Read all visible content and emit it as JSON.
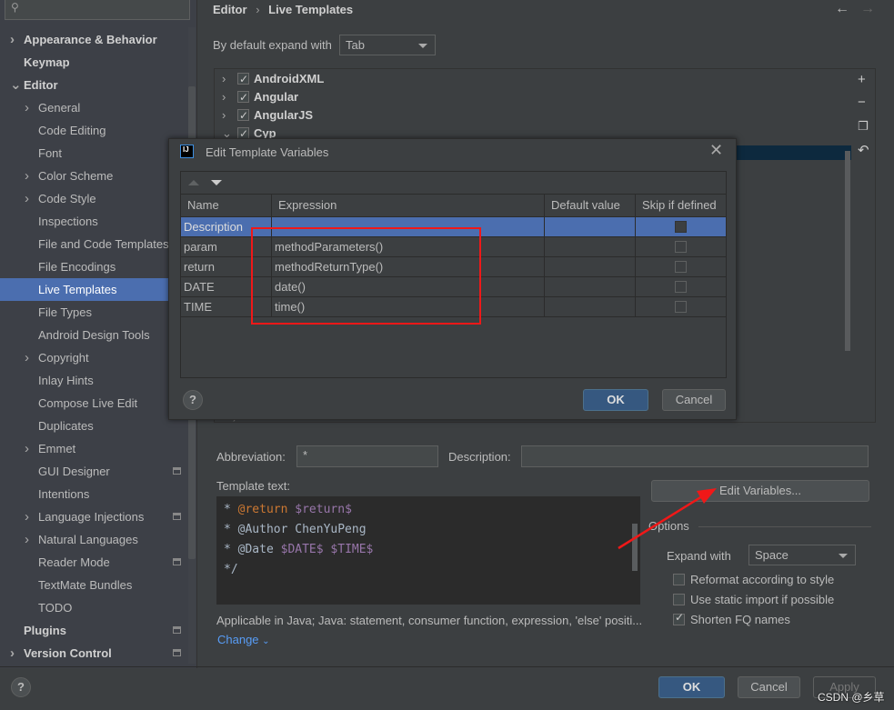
{
  "sidebar": {
    "items": [
      {
        "label": "Appearance & Behavior",
        "level": 0,
        "bold": true,
        "chevron": "right"
      },
      {
        "label": "Keymap",
        "level": 0,
        "bold": true
      },
      {
        "label": "Editor",
        "level": 0,
        "bold": true,
        "chevron": "down"
      },
      {
        "label": "General",
        "level": 1,
        "chevron": "right"
      },
      {
        "label": "Code Editing",
        "level": 1
      },
      {
        "label": "Font",
        "level": 1
      },
      {
        "label": "Color Scheme",
        "level": 1,
        "chevron": "right"
      },
      {
        "label": "Code Style",
        "level": 1,
        "chevron": "right"
      },
      {
        "label": "Inspections",
        "level": 1
      },
      {
        "label": "File and Code Templates",
        "level": 1
      },
      {
        "label": "File Encodings",
        "level": 1
      },
      {
        "label": "Live Templates",
        "level": 1,
        "selected": true
      },
      {
        "label": "File Types",
        "level": 1
      },
      {
        "label": "Android Design Tools",
        "level": 1
      },
      {
        "label": "Copyright",
        "level": 1,
        "chevron": "right"
      },
      {
        "label": "Inlay Hints",
        "level": 1
      },
      {
        "label": "Compose Live Edit",
        "level": 1
      },
      {
        "label": "Duplicates",
        "level": 1
      },
      {
        "label": "Emmet",
        "level": 1,
        "chevron": "right"
      },
      {
        "label": "GUI Designer",
        "level": 1,
        "icon": true
      },
      {
        "label": "Intentions",
        "level": 1
      },
      {
        "label": "Language Injections",
        "level": 1,
        "chevron": "right",
        "icon": true
      },
      {
        "label": "Natural Languages",
        "level": 1,
        "chevron": "right"
      },
      {
        "label": "Reader Mode",
        "level": 1,
        "icon": true
      },
      {
        "label": "TextMate Bundles",
        "level": 1
      },
      {
        "label": "TODO",
        "level": 1
      },
      {
        "label": "Plugins",
        "level": 0,
        "bold": true,
        "icon": true
      },
      {
        "label": "Version Control",
        "level": 0,
        "bold": true,
        "chevron": "right",
        "icon": true
      }
    ]
  },
  "breadcrumb": {
    "parent": "Editor",
    "sep": "›",
    "current": "Live Templates"
  },
  "expand_default": {
    "label": "By default expand with",
    "value": "Tab"
  },
  "tree": [
    {
      "label": "AndroidXML",
      "checked": true,
      "chevron": "›"
    },
    {
      "label": "Angular",
      "checked": true,
      "chevron": "›"
    },
    {
      "label": "AngularJS",
      "checked": true,
      "chevron": "›"
    },
    {
      "label": "Cyp",
      "checked": true,
      "chevron": "⌄"
    }
  ],
  "dialog": {
    "title": "Edit Template Variables",
    "columns": [
      "Name",
      "Expression",
      "Default value",
      "Skip if defined"
    ],
    "rows": [
      {
        "name": "Description",
        "expression": "",
        "default": "",
        "skip": false,
        "selected": true
      },
      {
        "name": "param",
        "expression": "methodParameters()",
        "default": "",
        "skip": false
      },
      {
        "name": "return",
        "expression": "methodReturnType()",
        "default": "",
        "skip": false
      },
      {
        "name": "DATE",
        "expression": "date()",
        "default": "",
        "skip": false
      },
      {
        "name": "TIME",
        "expression": "time()",
        "default": "",
        "skip": false
      }
    ],
    "help": "?",
    "ok": "OK",
    "cancel": "Cancel"
  },
  "form": {
    "abbreviation_label": "Abbreviation:",
    "abbreviation_value": "*",
    "description_label": "Description:",
    "description_value": "",
    "template_label": "Template text:",
    "template_lines": [
      [
        "* ",
        "@return",
        " ",
        "$return$"
      ],
      [
        "* ",
        "@Author ChenYuPeng",
        "",
        ""
      ],
      [
        "* ",
        "@Date",
        " ",
        "$DATE$ $TIME$"
      ],
      [
        "*/",
        "",
        "",
        ""
      ]
    ],
    "edit_variables": "Edit Variables...",
    "options_label": "Options",
    "expand_label": "Expand with",
    "expand_value": "Space",
    "options": [
      {
        "label": "Reformat according to style",
        "checked": false
      },
      {
        "label": "Use static import if possible",
        "checked": false
      },
      {
        "label": "Shorten FQ names",
        "checked": true
      }
    ],
    "applicable": "Applicable in Java; Java: statement, consumer function, expression, 'else' positi...",
    "change": "Change"
  },
  "footer": {
    "ok": "OK",
    "cancel": "Cancel",
    "apply": "Apply",
    "help": "?"
  },
  "watermark": "CSDN @乡草",
  "colors": {
    "selection": "#4b6eaf",
    "annotation_red": "#f01818",
    "primary_button": "#365880"
  }
}
